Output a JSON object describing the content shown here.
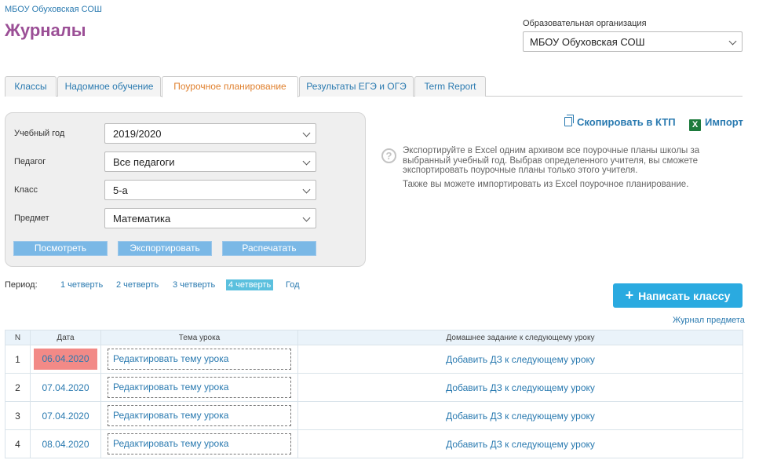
{
  "header": {
    "school_link": "МБОУ Обуховская СОШ",
    "title": "Журналы",
    "org_label": "Образовательная организация",
    "org_value": "МБОУ Обуховская СОШ"
  },
  "tabs": [
    {
      "label": "Классы",
      "active": false
    },
    {
      "label": "Надомное обучение",
      "active": false
    },
    {
      "label": "Поурочное планирование",
      "active": true
    },
    {
      "label": "Результаты ЕГЭ и ОГЭ",
      "active": false
    },
    {
      "label": "Term Report",
      "active": false
    }
  ],
  "filters": {
    "year_label": "Учебный год",
    "year_value": "2019/2020",
    "teacher_label": "Педагог",
    "teacher_value": "Все педагоги",
    "class_label": "Класс",
    "class_value": "5-а",
    "subject_label": "Предмет",
    "subject_value": "Математика",
    "view_button": "Посмотреть",
    "export_button": "Экспортировать",
    "print_button": "Распечатать"
  },
  "actions": {
    "copy_ktp": "Скопировать в КТП",
    "import": "Импорт",
    "xls_glyph": "X",
    "help_glyph": "?",
    "help_text": "Экспортируйте в Excel одним архивом все поурочные планы школы за выбранный учебный год. Выбрав определенного учителя, вы сможете экспортировать поурочные планы только этого учителя.",
    "help_text2": "Также вы можете импортировать из Excel поурочное планирование."
  },
  "period": {
    "label": "Период:",
    "items": [
      {
        "label": "1 четверть",
        "active": false
      },
      {
        "label": "2 четверть",
        "active": false
      },
      {
        "label": "3 четверть",
        "active": false
      },
      {
        "label": "4 четверть",
        "active": true
      },
      {
        "label": "Год",
        "active": false
      }
    ]
  },
  "write_button": "Написать классу",
  "journal_link": "Журнал предмета",
  "table": {
    "headers": [
      "N",
      "Дата",
      "Тема урока",
      "Домашнее задание к следующему уроку"
    ],
    "rows": [
      {
        "n": "1",
        "date": "06.04.2020",
        "topic": "Редактировать тему урока",
        "hw": "Добавить ДЗ к следующему уроку",
        "highlight": true
      },
      {
        "n": "2",
        "date": "07.04.2020",
        "topic": "Редактировать тему урока",
        "hw": "Добавить ДЗ к следующему уроку",
        "highlight": false
      },
      {
        "n": "3",
        "date": "07.04.2020",
        "topic": "Редактировать тему урока",
        "hw": "Добавить ДЗ к следующему уроку",
        "highlight": false
      },
      {
        "n": "4",
        "date": "08.04.2020",
        "topic": "Редактировать тему урока",
        "hw": "Добавить ДЗ к следующему уроку",
        "highlight": false
      }
    ]
  },
  "colors": {
    "accent": "#2a7ab0",
    "title": "#9b4f96",
    "active_tab": "#e0812f",
    "today_highlight": "#f28a87",
    "primary_button": "#2aaae0"
  }
}
